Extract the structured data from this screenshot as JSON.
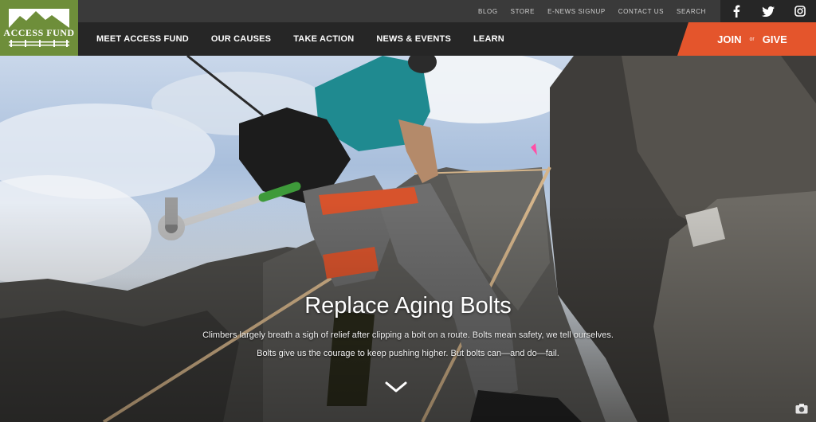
{
  "logo": {
    "text": "ACCESS FUND",
    "icon": "mountain-logo"
  },
  "utility_nav": [
    "BLOG",
    "STORE",
    "E-NEWS SIGNUP",
    "CONTACT US",
    "SEARCH"
  ],
  "social": [
    {
      "name": "facebook-icon",
      "glyph": "f"
    },
    {
      "name": "twitter-icon",
      "glyph": "t"
    },
    {
      "name": "instagram-icon",
      "glyph": "i"
    }
  ],
  "main_nav": [
    "MEET ACCESS FUND",
    "OUR CAUSES",
    "TAKE ACTION",
    "NEWS & EVENTS",
    "LEARN"
  ],
  "cta": {
    "join": "JOIN",
    "or": "or",
    "give": "GIVE",
    "color": "#e4552c"
  },
  "hero": {
    "title": "Replace Aging Bolts",
    "text": "Climbers largely breath a sigh of relief after clipping a bolt on a route. Bolts mean safety, we tell ourselves. Bolts give us the courage to keep pushing higher. But bolts can—and do—fail."
  },
  "colors": {
    "header": "#262626",
    "utility": "#3a3a3a",
    "logo_bg": "#6e8e3a",
    "accent": "#e4552c"
  }
}
